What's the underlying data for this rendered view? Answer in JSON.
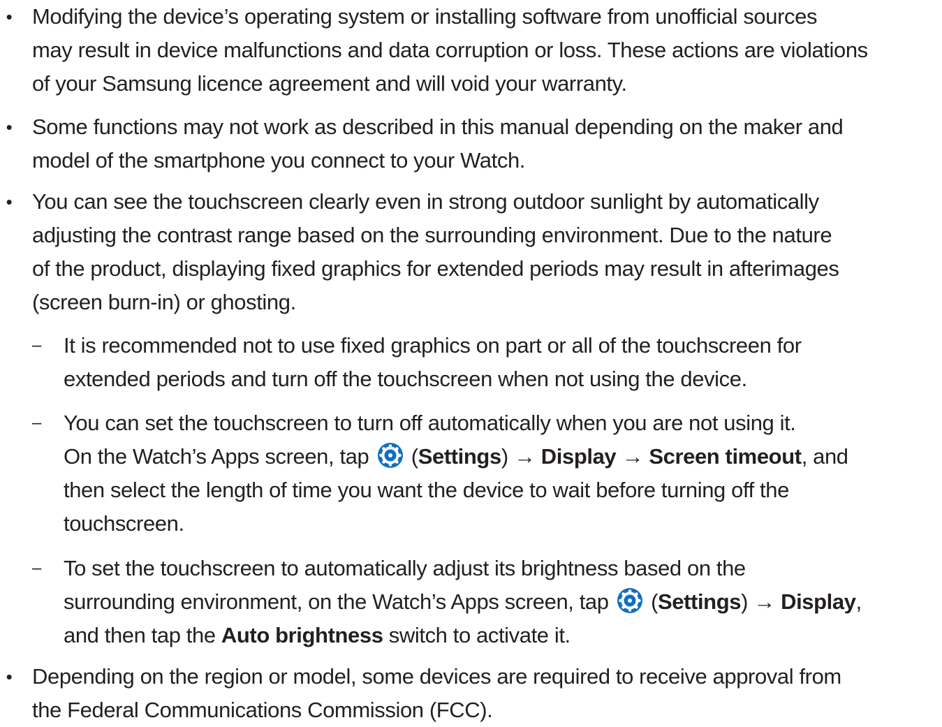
{
  "bullet_char": "•",
  "dash_char": "–",
  "arrow": "→",
  "icon_color": "#0f6fbf",
  "items": [
    {
      "lines": [
        "Modifying the device’s operating system or installing software from unofficial sources",
        "may result in device malfunctions and data corruption or loss. These actions are violations",
        "of your Samsung licence agreement and will void your warranty."
      ]
    },
    {
      "lines": [
        "Some functions may not work as described in this manual depending on the maker and",
        "model of the smartphone you connect to your Watch."
      ]
    },
    {
      "lines": [
        "You can see the touchscreen clearly even in strong outdoor sunlight by automatically",
        "adjusting the contrast range based on the surrounding environment. Due to the nature",
        "of the product, displaying fixed graphics for extended periods may result in afterimages",
        "(screen burn-in) or ghosting."
      ]
    }
  ],
  "subitems": {
    "s1": {
      "lines": [
        "It is recommended not to use fixed graphics on part or all of the touchscreen for",
        "extended periods and turn off the touchscreen when not using the device."
      ]
    },
    "s2": {
      "line1": "You can set the touchscreen to turn off automatically when you are not using it.",
      "line2_pre": "On the Watch’s Apps screen, tap",
      "settings": "Settings",
      "display": "Display",
      "screen_timeout": "Screen timeout",
      "line2_post": ", and",
      "line3": "then select the length of time you want the device to wait before turning off the",
      "line4": "touchscreen."
    },
    "s3": {
      "line1": "To set the touchscreen to automatically adjust its brightness based on the",
      "line2_pre": "surrounding environment, on the Watch’s Apps screen, tap",
      "settings": "Settings",
      "display": "Display",
      "line3_pre": "and then tap the",
      "auto_brightness": "Auto brightness",
      "line3_post": "switch to activate it."
    }
  },
  "last_item": {
    "lines": [
      "Depending on the region or model, some devices are required to receive approval from",
      "the Federal Communications Commission (FCC)."
    ]
  }
}
